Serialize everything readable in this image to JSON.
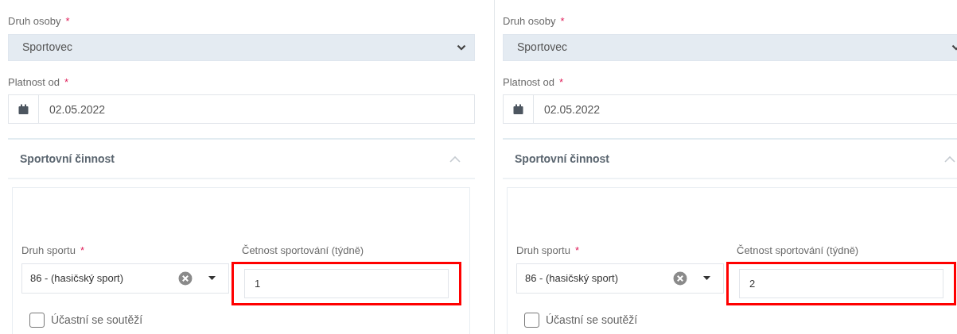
{
  "panels": [
    {
      "person_type": {
        "label": "Druh osoby",
        "required_mark": "*",
        "value": "Sportovec"
      },
      "valid_from": {
        "label": "Platnost od",
        "required_mark": "*",
        "value": "02.05.2022"
      },
      "section": {
        "title": "Sportovní činnost",
        "expanded": true,
        "sport": {
          "label": "Druh sportu",
          "required_mark": "*",
          "value": "86 - (hasičský sport)"
        },
        "frequency": {
          "label": "Četnost sportování (týdně)",
          "value": "1",
          "highlighted": true
        },
        "competes": {
          "label": "Účastní se soutěží",
          "checked": false
        }
      }
    },
    {
      "person_type": {
        "label": "Druh osoby",
        "required_mark": "*",
        "value": "Sportovec"
      },
      "valid_from": {
        "label": "Platnost od",
        "required_mark": "*",
        "value": "02.05.2022"
      },
      "section": {
        "title": "Sportovní činnost",
        "expanded": true,
        "sport": {
          "label": "Druh sportu",
          "required_mark": "*",
          "value": "86 - (hasičský sport)"
        },
        "frequency": {
          "label": "Četnost sportování (týdně)",
          "value": "2",
          "highlighted": true
        },
        "competes": {
          "label": "Účastní se soutěží",
          "checked": false
        }
      }
    }
  ]
}
